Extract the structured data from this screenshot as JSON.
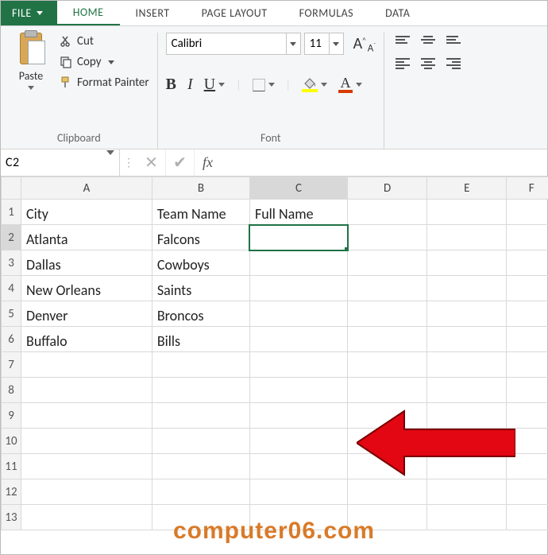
{
  "tabs": {
    "file": "FILE",
    "home": "HOME",
    "insert": "INSERT",
    "page_layout": "PAGE LAYOUT",
    "formulas": "FORMULAS",
    "data": "DATA"
  },
  "ribbon": {
    "clipboard": {
      "paste": "Paste",
      "cut": "Cut",
      "copy": "Copy",
      "format_painter": "Format Painter",
      "group_label": "Clipboard"
    },
    "font": {
      "name": "Calibri",
      "size": "11",
      "bold": "B",
      "italic": "I",
      "underline": "U",
      "group_label": "Font"
    }
  },
  "namebox": "C2",
  "fx_label": "fx",
  "columns": [
    "A",
    "B",
    "C",
    "D",
    "E",
    "F"
  ],
  "rows": [
    "1",
    "2",
    "3",
    "4",
    "5",
    "6",
    "7",
    "8",
    "9",
    "10",
    "11",
    "12",
    "13"
  ],
  "sheet_data": {
    "A1": "City",
    "B1": "Team Name",
    "C1": "Full Name",
    "A2": "Atlanta",
    "B2": "Falcons",
    "A3": "Dallas",
    "B3": "Cowboys",
    "A4": "New Orleans",
    "B4": "Saints",
    "A5": "Denver",
    "B5": "Broncos",
    "A6": "Buffalo",
    "B6": "Bills"
  },
  "watermark": "computer06.com"
}
